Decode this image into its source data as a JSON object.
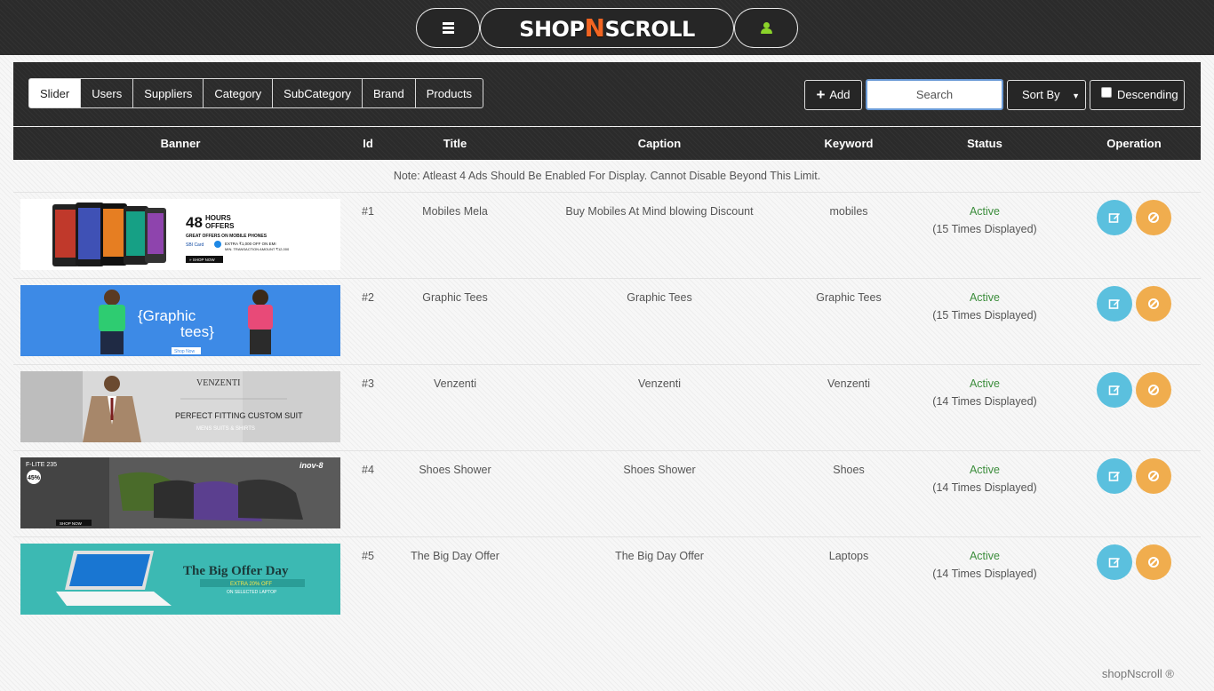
{
  "header": {
    "logo_part1": "SHOP",
    "logo_n": "N",
    "logo_part2": "SCROLL"
  },
  "tabs": [
    "Slider",
    "Users",
    "Suppliers",
    "Category",
    "SubCategory",
    "Brand",
    "Products"
  ],
  "toolbar": {
    "add_label": "Add",
    "search_placeholder": "Search",
    "sort_label": "Sort By",
    "descending_label": "Descending"
  },
  "table": {
    "headers": {
      "banner": "Banner",
      "id": "Id",
      "title": "Title",
      "caption": "Caption",
      "keyword": "Keyword",
      "status": "Status",
      "operation": "Operation"
    },
    "note": "Note: Atleast 4 Ads Should Be Enabled For Display. Cannot Disable Beyond This Limit.",
    "rows": [
      {
        "id": "#1",
        "title": "Mobiles Mela",
        "caption": "Buy Mobiles At Mind blowing Discount",
        "keyword": "mobiles",
        "status": "Active",
        "displayed": "(15 Times Displayed)",
        "banner": {
          "headline": "48",
          "sub1": "HOURS",
          "sub2": "OFFERS",
          "line1": "GREAT OFFERS ON MOBILE PHONES",
          "card": "SBI Card",
          "extra": "EXTRA ₹1,000 OFF ON EMI",
          "min": "MIN. TRANSACTION AMOUNT ₹12,000",
          "cta": "» SHOP NOW"
        }
      },
      {
        "id": "#2",
        "title": "Graphic Tees",
        "caption": "Graphic Tees",
        "keyword": "Graphic Tees",
        "status": "Active",
        "displayed": "(15 Times Displayed)",
        "banner": {
          "headline": "{Graphic",
          "headline2": "tees}",
          "cta": "Shop Now"
        }
      },
      {
        "id": "#3",
        "title": "Venzenti",
        "caption": "Venzenti",
        "keyword": "Venzenti",
        "status": "Active",
        "displayed": "(14 Times Displayed)",
        "banner": {
          "brand": "VENZENTI",
          "tag": "PERFECT FITTING CUSTOM SUIT",
          "sub": "MENS SUITS & SHIRTS"
        }
      },
      {
        "id": "#4",
        "title": "Shoes Shower",
        "caption": "Shoes Shower",
        "keyword": "Shoes",
        "status": "Active",
        "displayed": "(14 Times Displayed)",
        "banner": {
          "model": "F-LITE 235",
          "discount": "45%",
          "brand": "inov-8",
          "cta": "SHOP NOW"
        }
      },
      {
        "id": "#5",
        "title": "The Big Day Offer",
        "caption": "The Big Day Offer",
        "keyword": "Laptops",
        "status": "Active",
        "displayed": "(14 Times Displayed)",
        "banner": {
          "headline": "The Big Offer Day",
          "extra": "EXTRA 20% OFF",
          "sub": "ON SELECTED LAPTOP"
        }
      }
    ]
  },
  "footer": {
    "text": "shopNscroll ®"
  },
  "colors": {
    "dark": "#2b2b2b",
    "edit_button": "#5bc0de",
    "disable_button": "#f0ad4e",
    "active_status": "#3c8d3c",
    "logo_accent": "#f26522",
    "user_icon": "#8bd32a"
  }
}
